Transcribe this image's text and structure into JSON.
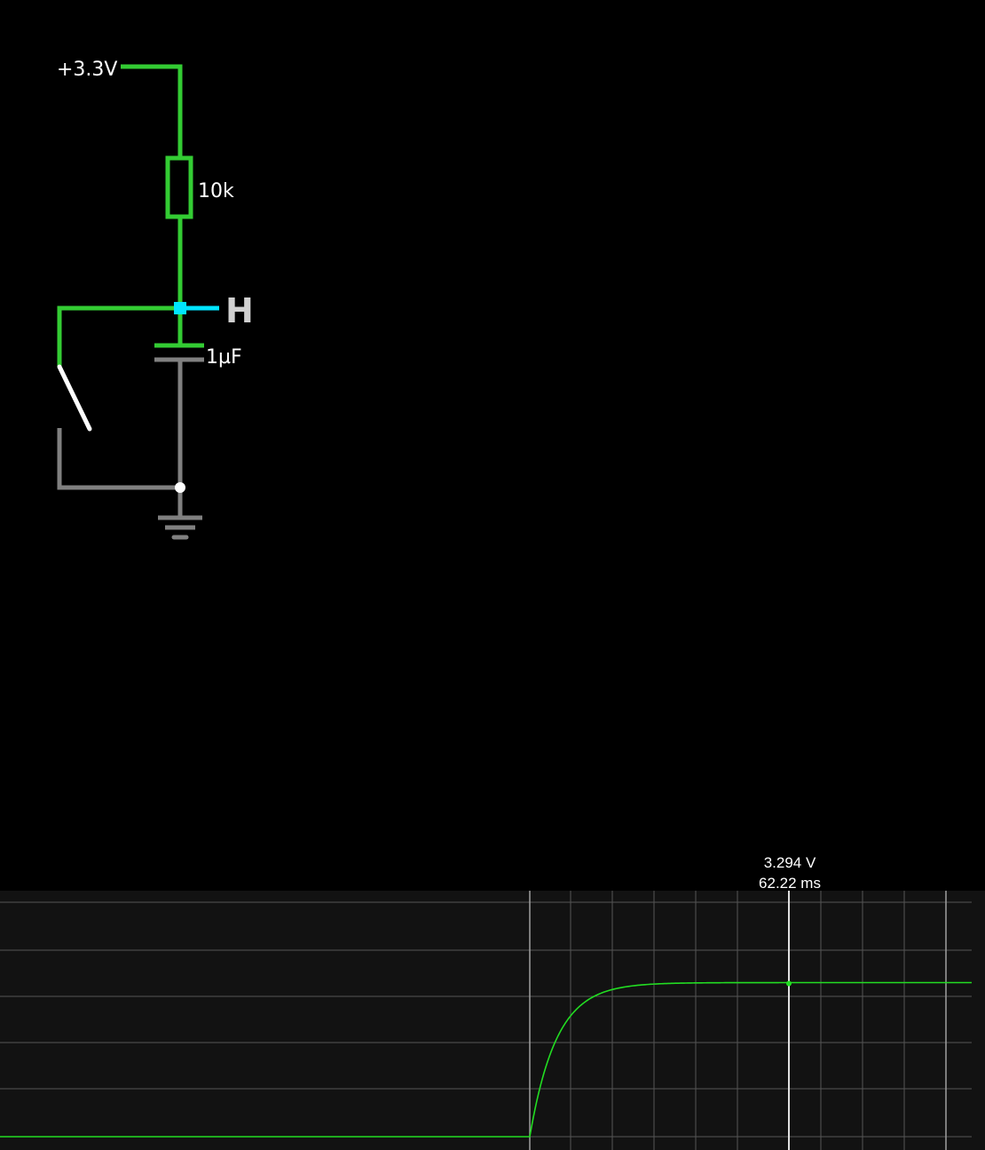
{
  "circuit": {
    "supply_label": "+3.3V",
    "resistor_label": "10k",
    "capacitor_label": "1µF",
    "probe_label": "H",
    "colors": {
      "high_wire": "#33cc33",
      "ground_wire": "#808080",
      "probe": "#00e5ff",
      "switch": "#ffffff",
      "probe_label": "#d0d0d0"
    }
  },
  "scope": {
    "cursor": {
      "voltage": "3.294 V",
      "time": "62.22 ms"
    },
    "colors": {
      "background": "#121212",
      "trace": "#22dd22",
      "grid": "#555555",
      "cursor": "#e0e0e0"
    }
  }
}
